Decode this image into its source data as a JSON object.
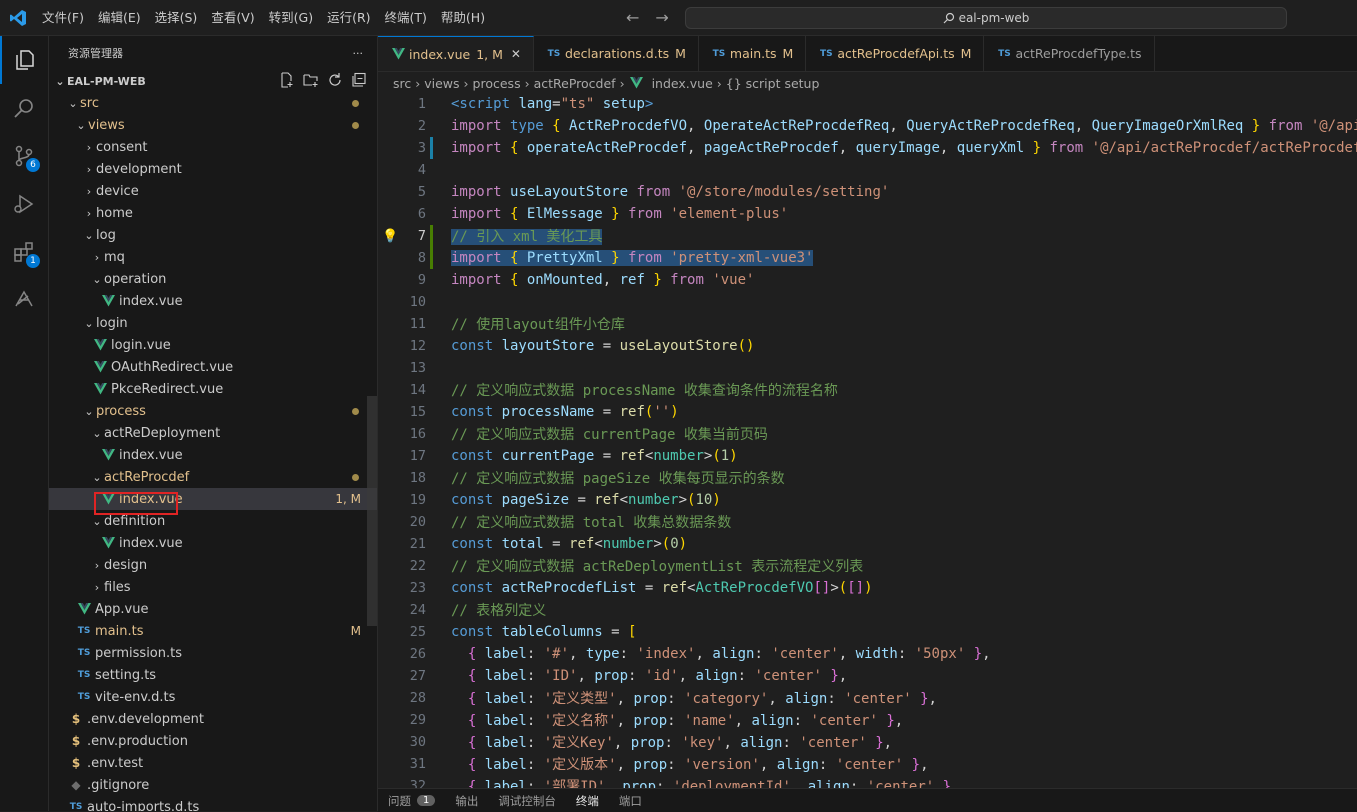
{
  "menu": [
    "文件(F)",
    "编辑(E)",
    "选择(S)",
    "查看(V)",
    "转到(G)",
    "运行(R)",
    "终端(T)",
    "帮助(H)"
  ],
  "search": {
    "text": "eal-pm-web"
  },
  "activity": {
    "source_control_badge": "6",
    "extensions_badge": "1"
  },
  "sidebar": {
    "title": "资源管理器",
    "project": "EAL-PM-WEB",
    "rows": [
      {
        "label": "src",
        "kind": "folder",
        "open": true,
        "indent": 1,
        "orange": true,
        "dot": true
      },
      {
        "label": "views",
        "kind": "folder",
        "open": true,
        "indent": 2,
        "orange": true,
        "dot": true
      },
      {
        "label": "consent",
        "kind": "folder",
        "open": false,
        "indent": 3
      },
      {
        "label": "development",
        "kind": "folder",
        "open": false,
        "indent": 3
      },
      {
        "label": "device",
        "kind": "folder",
        "open": false,
        "indent": 3
      },
      {
        "label": "home",
        "kind": "folder",
        "open": false,
        "indent": 3
      },
      {
        "label": "log",
        "kind": "folder",
        "open": true,
        "indent": 3
      },
      {
        "label": "mq",
        "kind": "folder",
        "open": false,
        "indent": 4
      },
      {
        "label": "operation",
        "kind": "folder",
        "open": true,
        "indent": 4
      },
      {
        "label": "index.vue",
        "kind": "vue",
        "indent": 5
      },
      {
        "label": "login",
        "kind": "folder",
        "open": true,
        "indent": 3
      },
      {
        "label": "login.vue",
        "kind": "vue",
        "indent": 4
      },
      {
        "label": "OAuthRedirect.vue",
        "kind": "vue",
        "indent": 4
      },
      {
        "label": "PkceRedirect.vue",
        "kind": "vue",
        "indent": 4
      },
      {
        "label": "process",
        "kind": "folder",
        "open": true,
        "indent": 3,
        "orange": true,
        "dot": true
      },
      {
        "label": "actReDeployment",
        "kind": "folder",
        "open": true,
        "indent": 4
      },
      {
        "label": "index.vue",
        "kind": "vue",
        "indent": 5
      },
      {
        "label": "actReProcdef",
        "kind": "folder",
        "open": true,
        "indent": 4,
        "orange": true,
        "dot": true
      },
      {
        "label": "index.vue",
        "kind": "vue",
        "indent": 5,
        "orange": true,
        "selected": true,
        "status": "1, M"
      },
      {
        "label": "definition",
        "kind": "folder",
        "open": true,
        "indent": 4
      },
      {
        "label": "index.vue",
        "kind": "vue",
        "indent": 5
      },
      {
        "label": "design",
        "kind": "folder",
        "open": false,
        "indent": 4
      },
      {
        "label": "files",
        "kind": "folder",
        "open": false,
        "indent": 4
      },
      {
        "label": "App.vue",
        "kind": "vue",
        "indent": 2
      },
      {
        "label": "main.ts",
        "kind": "ts",
        "indent": 2,
        "orange": true,
        "status": "M"
      },
      {
        "label": "permission.ts",
        "kind": "ts",
        "indent": 2
      },
      {
        "label": "setting.ts",
        "kind": "ts",
        "indent": 2
      },
      {
        "label": "vite-env.d.ts",
        "kind": "ts",
        "indent": 2
      },
      {
        "label": ".env.development",
        "kind": "env",
        "indent": 1
      },
      {
        "label": ".env.production",
        "kind": "env",
        "indent": 1
      },
      {
        "label": ".env.test",
        "kind": "env",
        "indent": 1
      },
      {
        "label": ".gitignore",
        "kind": "git",
        "indent": 1
      },
      {
        "label": "auto-imports.d.ts",
        "kind": "ts",
        "indent": 1
      }
    ]
  },
  "tabs": [
    {
      "label": "index.vue",
      "kind": "vue",
      "status": "1, M",
      "active": true
    },
    {
      "label": "declarations.d.ts",
      "kind": "ts",
      "status": "M"
    },
    {
      "label": "main.ts",
      "kind": "ts",
      "status": "M"
    },
    {
      "label": "actReProcdefApi.ts",
      "kind": "ts",
      "status": "M"
    },
    {
      "label": "actReProcdefType.ts",
      "kind": "ts",
      "status": ""
    }
  ],
  "breadcrumbs": [
    "src",
    "views",
    "process",
    "actReProcdef",
    "index.vue",
    "{} script setup"
  ],
  "code": [
    {
      "n": "1",
      "t": [
        [
          "tag",
          "<script "
        ],
        [
          "attr",
          "lang"
        ],
        [
          "plain",
          "="
        ],
        [
          "str",
          "\"ts\" "
        ],
        [
          "attr",
          "setup"
        ],
        [
          "tag",
          ">"
        ]
      ]
    },
    {
      "n": "2",
      "t": [
        [
          "ctl",
          "import "
        ],
        [
          "kw",
          "type "
        ],
        [
          "br1",
          "{ "
        ],
        [
          "var",
          "ActReProcdefVO"
        ],
        [
          "plain",
          ", "
        ],
        [
          "var",
          "OperateActReProcdefReq"
        ],
        [
          "plain",
          ", "
        ],
        [
          "var",
          "QueryActReProcdefReq"
        ],
        [
          "plain",
          ", "
        ],
        [
          "var",
          "QueryImageOrXmlReq "
        ],
        [
          "br1",
          "} "
        ],
        [
          "ctl",
          "from "
        ],
        [
          "str",
          "'@/api/actReProcdef/actReProcdefType'"
        ]
      ]
    },
    {
      "n": "3",
      "t": [
        [
          "ctl",
          "import "
        ],
        [
          "br1",
          "{ "
        ],
        [
          "var",
          "operateActReProcdef"
        ],
        [
          "plain",
          ", "
        ],
        [
          "var",
          "pageActReProcdef"
        ],
        [
          "plain",
          ", "
        ],
        [
          "var",
          "queryImage"
        ],
        [
          "plain",
          ", "
        ],
        [
          "var",
          "queryXml "
        ],
        [
          "br1",
          "} "
        ],
        [
          "ctl",
          "from "
        ],
        [
          "str",
          "'@/api/actReProcdef/actReProcdefApi'"
        ]
      ]
    },
    {
      "n": "4",
      "t": []
    },
    {
      "n": "5",
      "t": [
        [
          "ctl",
          "import "
        ],
        [
          "var",
          "useLayoutStore "
        ],
        [
          "ctl",
          "from "
        ],
        [
          "str",
          "'@/store/modules/setting'"
        ]
      ]
    },
    {
      "n": "6",
      "t": [
        [
          "ctl",
          "import "
        ],
        [
          "br1",
          "{ "
        ],
        [
          "var",
          "ElMessage "
        ],
        [
          "br1",
          "} "
        ],
        [
          "ctl",
          "from "
        ],
        [
          "str",
          "'element-plus'"
        ]
      ]
    },
    {
      "n": "7",
      "hl": true,
      "t": [
        [
          "cm",
          "// 引入 xml 美化工具"
        ]
      ]
    },
    {
      "n": "8",
      "hl": true,
      "t": [
        [
          "ctl",
          "import "
        ],
        [
          "br1",
          "{ "
        ],
        [
          "var",
          "PrettyXml "
        ],
        [
          "br1",
          "} "
        ],
        [
          "ctl",
          "from "
        ],
        [
          "str",
          "'pretty-xml-vue3'"
        ]
      ]
    },
    {
      "n": "9",
      "t": [
        [
          "ctl",
          "import "
        ],
        [
          "br1",
          "{ "
        ],
        [
          "var",
          "onMounted"
        ],
        [
          "plain",
          ", "
        ],
        [
          "var",
          "ref "
        ],
        [
          "br1",
          "} "
        ],
        [
          "ctl",
          "from "
        ],
        [
          "str",
          "'vue'"
        ]
      ]
    },
    {
      "n": "10",
      "t": []
    },
    {
      "n": "11",
      "t": [
        [
          "cm",
          "// 使用layout组件小仓库"
        ]
      ]
    },
    {
      "n": "12",
      "t": [
        [
          "kw",
          "const "
        ],
        [
          "var",
          "layoutStore "
        ],
        [
          "plain",
          "= "
        ],
        [
          "fn",
          "useLayoutStore"
        ],
        [
          "br1",
          "()"
        ]
      ]
    },
    {
      "n": "13",
      "t": []
    },
    {
      "n": "14",
      "t": [
        [
          "cm",
          "// 定义响应式数据 processName 收集查询条件的流程名称"
        ]
      ]
    },
    {
      "n": "15",
      "t": [
        [
          "kw",
          "const "
        ],
        [
          "var",
          "processName "
        ],
        [
          "plain",
          "= "
        ],
        [
          "fn",
          "ref"
        ],
        [
          "br1",
          "("
        ],
        [
          "str",
          "''"
        ],
        [
          "br1",
          ")"
        ]
      ]
    },
    {
      "n": "16",
      "t": [
        [
          "cm",
          "// 定义响应式数据 currentPage 收集当前页码"
        ]
      ]
    },
    {
      "n": "17",
      "t": [
        [
          "kw",
          "const "
        ],
        [
          "var",
          "currentPage "
        ],
        [
          "plain",
          "= "
        ],
        [
          "fn",
          "ref"
        ],
        [
          "plain",
          "<"
        ],
        [
          "typ",
          "number"
        ],
        [
          "plain",
          ">"
        ],
        [
          "br1",
          "("
        ],
        [
          "num",
          "1"
        ],
        [
          "br1",
          ")"
        ]
      ]
    },
    {
      "n": "18",
      "t": [
        [
          "cm",
          "// 定义响应式数据 pageSize 收集每页显示的条数"
        ]
      ]
    },
    {
      "n": "19",
      "t": [
        [
          "kw",
          "const "
        ],
        [
          "var",
          "pageSize "
        ],
        [
          "plain",
          "= "
        ],
        [
          "fn",
          "ref"
        ],
        [
          "plain",
          "<"
        ],
        [
          "typ",
          "number"
        ],
        [
          "plain",
          ">"
        ],
        [
          "br1",
          "("
        ],
        [
          "num",
          "10"
        ],
        [
          "br1",
          ")"
        ]
      ]
    },
    {
      "n": "20",
      "t": [
        [
          "cm",
          "// 定义响应式数据 total 收集总数据条数"
        ]
      ]
    },
    {
      "n": "21",
      "t": [
        [
          "kw",
          "const "
        ],
        [
          "var",
          "total "
        ],
        [
          "plain",
          "= "
        ],
        [
          "fn",
          "ref"
        ],
        [
          "plain",
          "<"
        ],
        [
          "typ",
          "number"
        ],
        [
          "plain",
          ">"
        ],
        [
          "br1",
          "("
        ],
        [
          "num",
          "0"
        ],
        [
          "br1",
          ")"
        ]
      ]
    },
    {
      "n": "22",
      "t": [
        [
          "cm",
          "// 定义响应式数据 actReDeploymentList 表示流程定义列表"
        ]
      ]
    },
    {
      "n": "23",
      "t": [
        [
          "kw",
          "const "
        ],
        [
          "var",
          "actReProcdefList "
        ],
        [
          "plain",
          "= "
        ],
        [
          "fn",
          "ref"
        ],
        [
          "plain",
          "<"
        ],
        [
          "typ",
          "ActReProcdefVO"
        ],
        [
          "br2",
          "[]"
        ],
        [
          "plain",
          ">"
        ],
        [
          "br1",
          "("
        ],
        [
          "br2",
          "[]"
        ],
        [
          "br1",
          ")"
        ]
      ]
    },
    {
      "n": "24",
      "t": [
        [
          "cm",
          "// 表格列定义"
        ]
      ]
    },
    {
      "n": "25",
      "t": [
        [
          "kw",
          "const "
        ],
        [
          "var",
          "tableColumns "
        ],
        [
          "plain",
          "= "
        ],
        [
          "br1",
          "["
        ]
      ]
    },
    {
      "n": "26",
      "t": [
        [
          "plain",
          "  "
        ],
        [
          "br2",
          "{ "
        ],
        [
          "var",
          "label"
        ],
        [
          "plain",
          ": "
        ],
        [
          "str",
          "'#'"
        ],
        [
          "plain",
          ", "
        ],
        [
          "var",
          "type"
        ],
        [
          "plain",
          ": "
        ],
        [
          "str",
          "'index'"
        ],
        [
          "plain",
          ", "
        ],
        [
          "var",
          "align"
        ],
        [
          "plain",
          ": "
        ],
        [
          "str",
          "'center'"
        ],
        [
          "plain",
          ", "
        ],
        [
          "var",
          "width"
        ],
        [
          "plain",
          ": "
        ],
        [
          "str",
          "'50px' "
        ],
        [
          "br2",
          "}"
        ],
        [
          "plain",
          ","
        ]
      ]
    },
    {
      "n": "27",
      "t": [
        [
          "plain",
          "  "
        ],
        [
          "br2",
          "{ "
        ],
        [
          "var",
          "label"
        ],
        [
          "plain",
          ": "
        ],
        [
          "str",
          "'ID'"
        ],
        [
          "plain",
          ", "
        ],
        [
          "var",
          "prop"
        ],
        [
          "plain",
          ": "
        ],
        [
          "str",
          "'id'"
        ],
        [
          "plain",
          ", "
        ],
        [
          "var",
          "align"
        ],
        [
          "plain",
          ": "
        ],
        [
          "str",
          "'center' "
        ],
        [
          "br2",
          "}"
        ],
        [
          "plain",
          ","
        ]
      ]
    },
    {
      "n": "28",
      "t": [
        [
          "plain",
          "  "
        ],
        [
          "br2",
          "{ "
        ],
        [
          "var",
          "label"
        ],
        [
          "plain",
          ": "
        ],
        [
          "str",
          "'定义类型'"
        ],
        [
          "plain",
          ", "
        ],
        [
          "var",
          "prop"
        ],
        [
          "plain",
          ": "
        ],
        [
          "str",
          "'category'"
        ],
        [
          "plain",
          ", "
        ],
        [
          "var",
          "align"
        ],
        [
          "plain",
          ": "
        ],
        [
          "str",
          "'center' "
        ],
        [
          "br2",
          "}"
        ],
        [
          "plain",
          ","
        ]
      ]
    },
    {
      "n": "29",
      "t": [
        [
          "plain",
          "  "
        ],
        [
          "br2",
          "{ "
        ],
        [
          "var",
          "label"
        ],
        [
          "plain",
          ": "
        ],
        [
          "str",
          "'定义名称'"
        ],
        [
          "plain",
          ", "
        ],
        [
          "var",
          "prop"
        ],
        [
          "plain",
          ": "
        ],
        [
          "str",
          "'name'"
        ],
        [
          "plain",
          ", "
        ],
        [
          "var",
          "align"
        ],
        [
          "plain",
          ": "
        ],
        [
          "str",
          "'center' "
        ],
        [
          "br2",
          "}"
        ],
        [
          "plain",
          ","
        ]
      ]
    },
    {
      "n": "30",
      "t": [
        [
          "plain",
          "  "
        ],
        [
          "br2",
          "{ "
        ],
        [
          "var",
          "label"
        ],
        [
          "plain",
          ": "
        ],
        [
          "str",
          "'定义Key'"
        ],
        [
          "plain",
          ", "
        ],
        [
          "var",
          "prop"
        ],
        [
          "plain",
          ": "
        ],
        [
          "str",
          "'key'"
        ],
        [
          "plain",
          ", "
        ],
        [
          "var",
          "align"
        ],
        [
          "plain",
          ": "
        ],
        [
          "str",
          "'center' "
        ],
        [
          "br2",
          "}"
        ],
        [
          "plain",
          ","
        ]
      ]
    },
    {
      "n": "31",
      "t": [
        [
          "plain",
          "  "
        ],
        [
          "br2",
          "{ "
        ],
        [
          "var",
          "label"
        ],
        [
          "plain",
          ": "
        ],
        [
          "str",
          "'定义版本'"
        ],
        [
          "plain",
          ", "
        ],
        [
          "var",
          "prop"
        ],
        [
          "plain",
          ": "
        ],
        [
          "str",
          "'version'"
        ],
        [
          "plain",
          ", "
        ],
        [
          "var",
          "align"
        ],
        [
          "plain",
          ": "
        ],
        [
          "str",
          "'center' "
        ],
        [
          "br2",
          "}"
        ],
        [
          "plain",
          ","
        ]
      ]
    },
    {
      "n": "32",
      "t": [
        [
          "plain",
          "  "
        ],
        [
          "br2",
          "{ "
        ],
        [
          "var",
          "label"
        ],
        [
          "plain",
          ": "
        ],
        [
          "str",
          "'部署ID'"
        ],
        [
          "plain",
          ", "
        ],
        [
          "var",
          "prop"
        ],
        [
          "plain",
          ": "
        ],
        [
          "str",
          "'deploymentId'"
        ],
        [
          "plain",
          ", "
        ],
        [
          "var",
          "align"
        ],
        [
          "plain",
          ": "
        ],
        [
          "str",
          "'center' "
        ],
        [
          "br2",
          "}"
        ],
        [
          "plain",
          ","
        ]
      ]
    }
  ],
  "panel": {
    "tabs": [
      "问题",
      "输出",
      "调试控制台",
      "终端",
      "端口"
    ],
    "problems_badge": "1",
    "active": "终端"
  }
}
